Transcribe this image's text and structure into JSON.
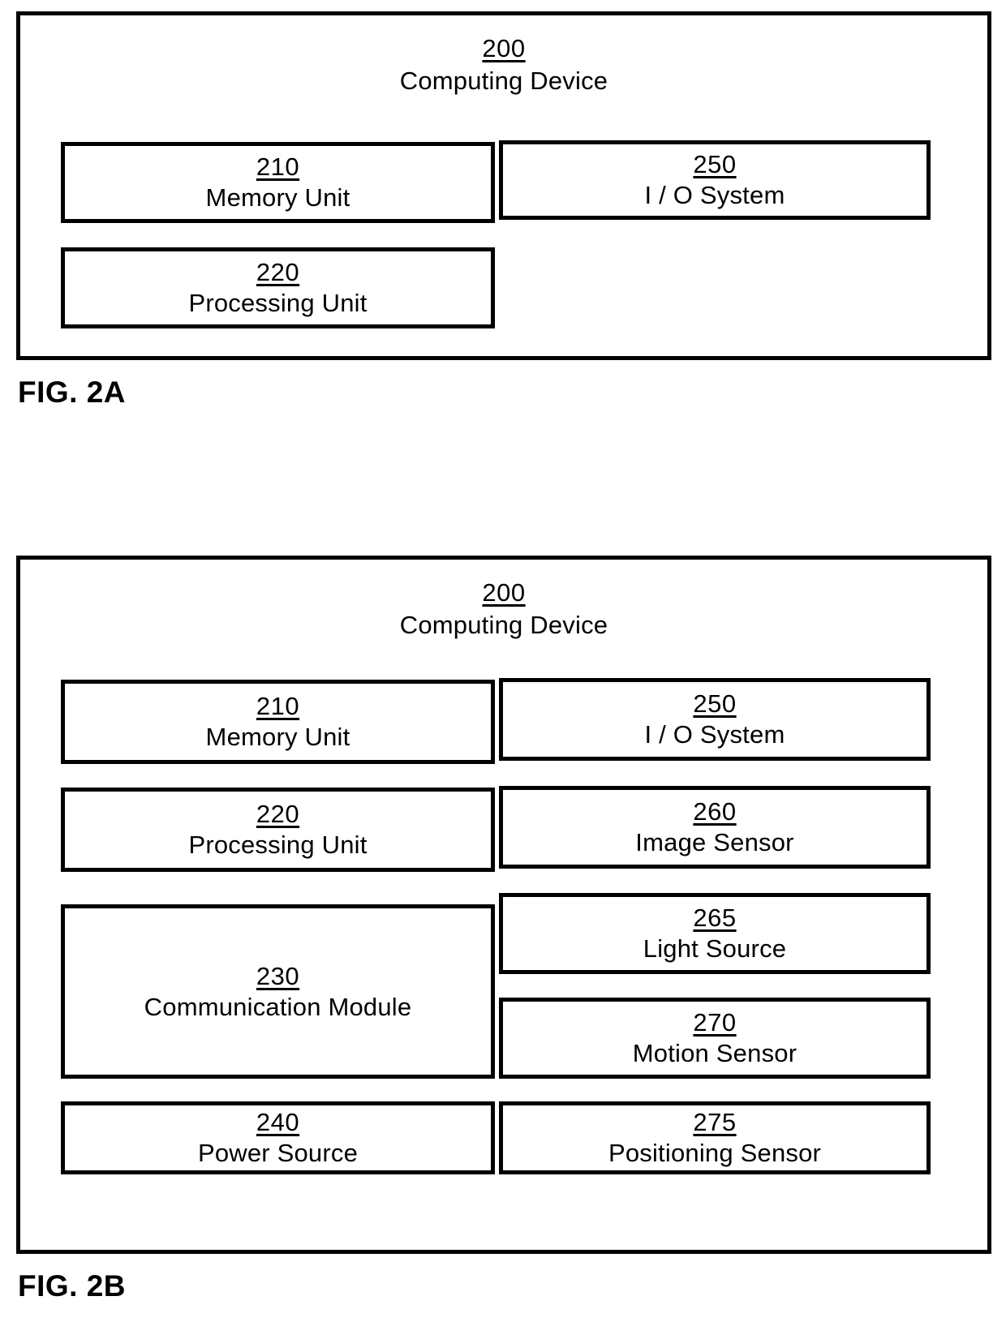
{
  "figures": [
    {
      "caption": "FIG. 2A",
      "device": {
        "ref": "200",
        "name": "Computing Device"
      },
      "components": [
        {
          "ref": "210",
          "name": "Memory Unit"
        },
        {
          "ref": "250",
          "name": "I / O System"
        },
        {
          "ref": "220",
          "name": "Processing Unit"
        }
      ]
    },
    {
      "caption": "FIG. 2B",
      "device": {
        "ref": "200",
        "name": "Computing Device"
      },
      "components": [
        {
          "ref": "210",
          "name": "Memory Unit"
        },
        {
          "ref": "250",
          "name": "I / O System"
        },
        {
          "ref": "220",
          "name": "Processing Unit"
        },
        {
          "ref": "260",
          "name": "Image Sensor"
        },
        {
          "ref": "230",
          "name": "Communication Module"
        },
        {
          "ref": "265",
          "name": "Light Source"
        },
        {
          "ref": "270",
          "name": "Motion Sensor"
        },
        {
          "ref": "240",
          "name": "Power Source"
        },
        {
          "ref": "275",
          "name": "Positioning  Sensor"
        }
      ]
    }
  ],
  "colors": {
    "ink": "#000000",
    "paper": "#ffffff"
  }
}
